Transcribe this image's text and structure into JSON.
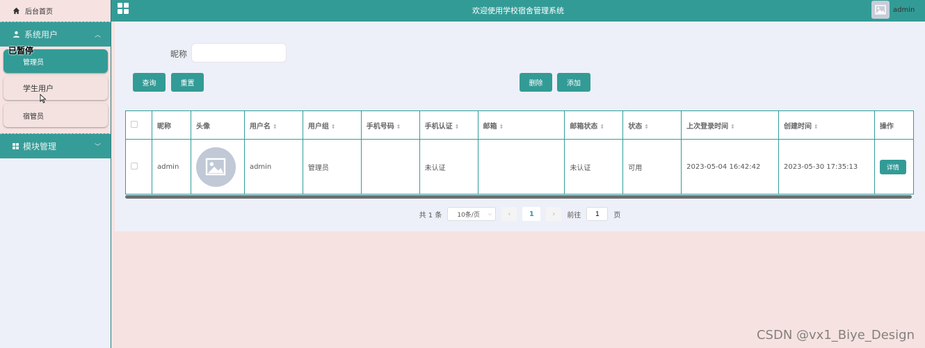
{
  "sidebar": {
    "home_label": "后台首页",
    "groups": [
      {
        "label": "系统用户",
        "expanded": true,
        "items": [
          {
            "label": "管理员",
            "active": true
          },
          {
            "label": "学生用户",
            "active": false
          },
          {
            "label": "宿管员",
            "active": false
          }
        ]
      },
      {
        "label": "模块管理",
        "expanded": false
      }
    ],
    "overlay_text": "已暂停"
  },
  "header": {
    "title": "欢迎使用学校宿舍管理系统",
    "user": "admin"
  },
  "filter": {
    "label": "昵称",
    "value": "",
    "placeholder": ""
  },
  "buttons": {
    "search": "查询",
    "reset": "重置",
    "delete": "删除",
    "add": "添加"
  },
  "table": {
    "columns": [
      "昵称",
      "头像",
      "用户名",
      "用户组",
      "手机号码",
      "手机认证",
      "邮箱",
      "邮箱状态",
      "状态",
      "上次登录时间",
      "创建时间",
      "操作"
    ],
    "rows": [
      {
        "nickname": "admin",
        "username": "admin",
        "group": "管理员",
        "phone": "",
        "phone_auth": "未认证",
        "email": "",
        "email_status": "未认证",
        "status": "可用",
        "last_login": "2023-05-04 16:42:42",
        "created": "2023-05-30 17:35:13",
        "action": "详情"
      }
    ]
  },
  "pagination": {
    "total": "共 1 条",
    "page_size": "10条/页",
    "current_page": "1",
    "goto_label": "前往",
    "goto_value": "1",
    "page_suffix": "页"
  },
  "watermark": "CSDN @vx1_Biye_Design",
  "colors": {
    "primary": "#339b96",
    "background": "#f6e3e1",
    "panel": "#edf0f8"
  }
}
